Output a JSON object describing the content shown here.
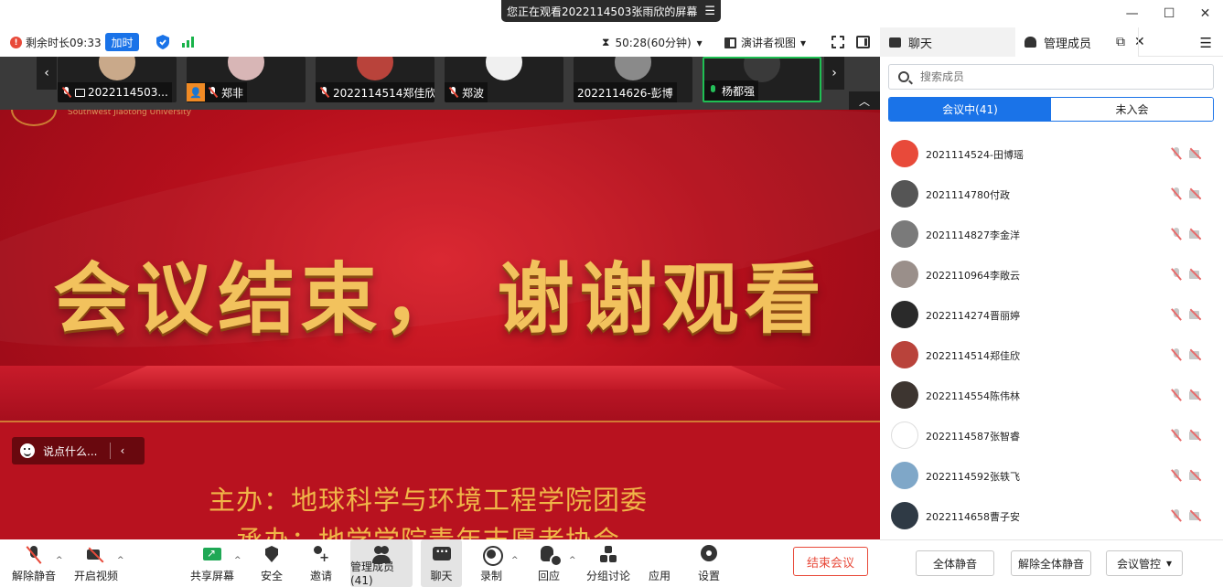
{
  "banner": {
    "text": "您正在观看2022114503张雨欣的屏幕",
    "menu_glyph": "☰"
  },
  "infobar": {
    "warn_glyph": "!",
    "remaining": "剩余时长09:33",
    "extend_label": "加时",
    "timer": "50:28(60分钟)",
    "timer_glyph": "⧗",
    "view_mode": "演讲者视图",
    "caret": "▾"
  },
  "strip": {
    "prev_glyph": "‹",
    "next_glyph": "›",
    "collapse_glyph": "︿",
    "tiles": [
      {
        "name": "2022114503...",
        "avatar_color": "#c9a98a"
      },
      {
        "name": "郑非",
        "avatar_color": "#d8b6b6"
      },
      {
        "name": "2022114514郑佳欣",
        "avatar_color": "#b9433b"
      },
      {
        "name": "郑波",
        "avatar_color": "#f0f0f0"
      },
      {
        "name": "2022114626-彭博",
        "avatar_color": "#8a8a8a"
      },
      {
        "name": "杨都强",
        "avatar_color": "#3a3a3a"
      }
    ]
  },
  "slide": {
    "title": "会议结束， 谢谢观看",
    "sponsor": "主办：地球科学与环境工程学院团委",
    "organizer": "承办：地学学院青年志愿者协会",
    "univ": "Southwest Jiaotong University"
  },
  "comment": {
    "placeholder": "说点什么...",
    "chev": "‹"
  },
  "toolbar": {
    "unmute": "解除静音",
    "video": "开启视频",
    "share": "共享屏幕",
    "security": "安全",
    "invite": "邀请",
    "members": "管理成员(41)",
    "chat": "聊天",
    "record": "录制",
    "react": "回应",
    "breakout": "分组讨论",
    "apps": "应用",
    "settings": "设置",
    "end": "结束会议",
    "caret": "^"
  },
  "panel": {
    "win_min": "—",
    "win_max": "☐",
    "win_close": "✕",
    "chat_tab": "聊天",
    "members_tab": "管理成员",
    "popout_glyph": "⧉",
    "close_glyph": "✕",
    "menu_glyph": "☰",
    "search_placeholder": "搜索成员",
    "in_meeting": "会议中(41)",
    "not_joined": "未入会",
    "members": [
      {
        "name": "2021114524-田博瑶",
        "color": "#e84a3a"
      },
      {
        "name": "2021114780付政",
        "color": "#555555"
      },
      {
        "name": "2021114827李金洋",
        "color": "#7a7a7a"
      },
      {
        "name": "2022110964李敞云",
        "color": "#9a8f8a"
      },
      {
        "name": "2022114274晋丽婷",
        "color": "#2a2a2a"
      },
      {
        "name": "2022114514郑佳欣",
        "color": "#b9433b"
      },
      {
        "name": "2022114554陈伟林",
        "color": "#3d3530"
      },
      {
        "name": "2022114587张智睿",
        "color": "#ffffff"
      },
      {
        "name": "2022114592张轶飞",
        "color": "#7fa7c8"
      },
      {
        "name": "2022114658曹子安",
        "color": "#2f3a45"
      }
    ],
    "mute_all": "全体静音",
    "unmute_all": "解除全体静音",
    "control": "会议管控"
  },
  "colors": {
    "accent": "#1a73e8",
    "danger": "#e84a3a",
    "green": "#1fbf53"
  }
}
